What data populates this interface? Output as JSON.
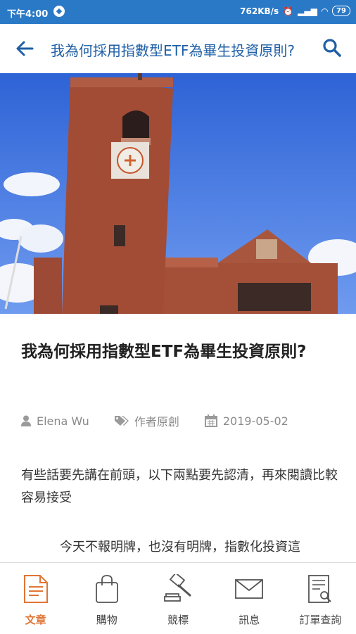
{
  "status_bar": {
    "time": "下午4:00",
    "network_speed": "762KB/s",
    "battery": "79"
  },
  "app_bar": {
    "title": "我為何採用指數型ETF為畢生投資原則?"
  },
  "article": {
    "title": "我為何採用指數型ETF為畢生投資原則?",
    "author": "Elena Wu",
    "category": "作者原創",
    "date": "2019-05-02",
    "paragraph_1": "有些話要先講在前頭，以下兩點要先認清，再來閱讀比較容易接受",
    "paragraph_2": "今天不報明牌，也沒有明牌，指數化投資這"
  },
  "tabs": [
    {
      "label": "文章",
      "icon": "document-icon",
      "active": true
    },
    {
      "label": "購物",
      "icon": "shopping-bag-icon",
      "active": false
    },
    {
      "label": "競標",
      "icon": "gavel-icon",
      "active": false
    },
    {
      "label": "訊息",
      "icon": "envelope-icon",
      "active": false
    },
    {
      "label": "訂單查詢",
      "icon": "order-search-icon",
      "active": false
    }
  ],
  "colors": {
    "status_bar": "#2a79c7",
    "title_blue": "#1f5fa6",
    "active_tab": "#e07535"
  }
}
